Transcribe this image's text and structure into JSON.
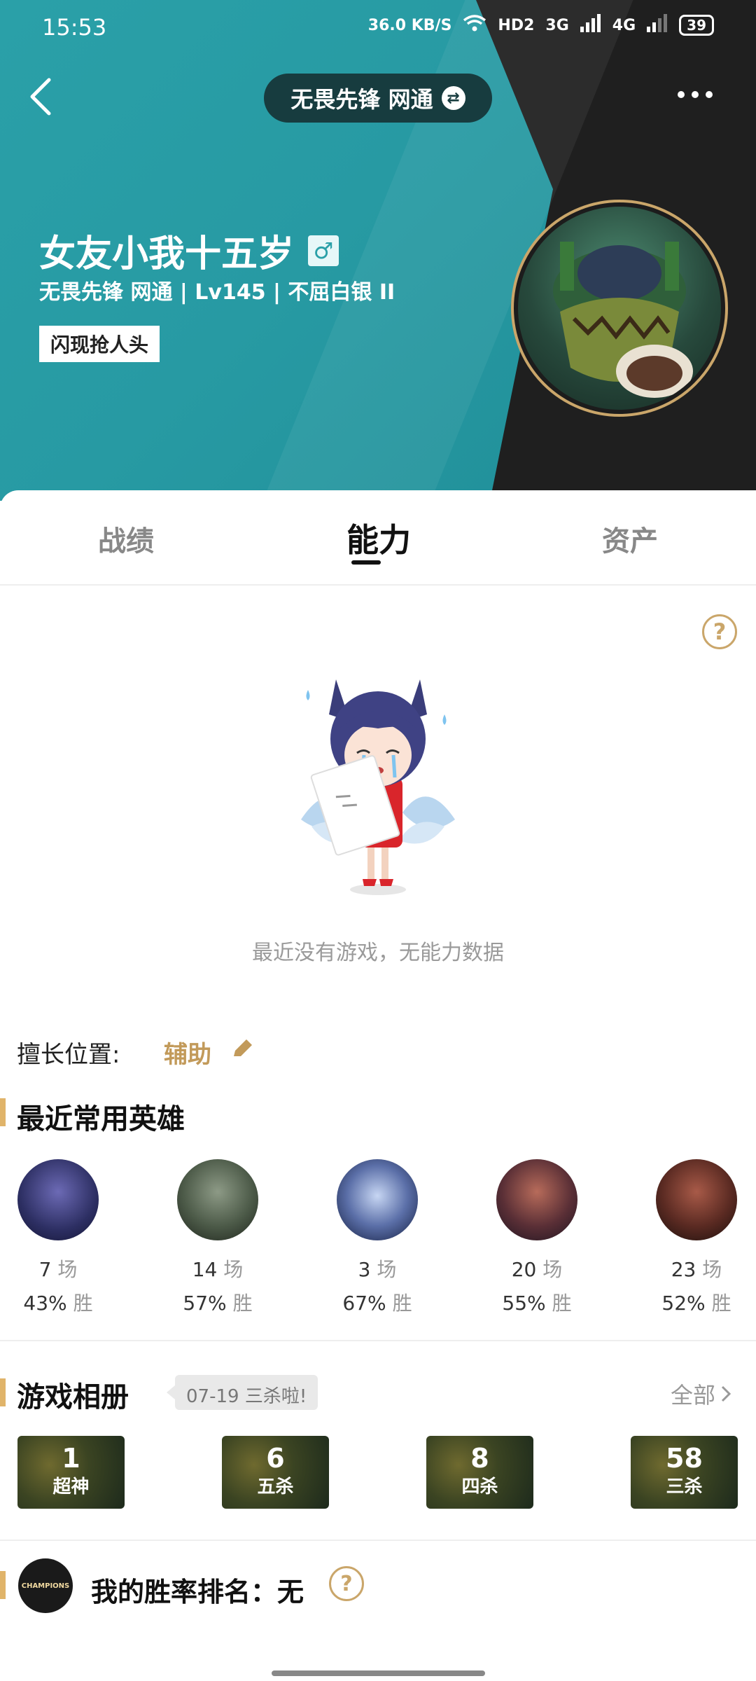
{
  "status_bar": {
    "time": "15:53",
    "net_speed": "36.0 KB/S",
    "hd": "HD2",
    "sig1": "3G",
    "sig2": "4G",
    "battery": "39"
  },
  "header": {
    "server": "无畏先锋 网通",
    "player_name": "女友小我十五岁",
    "gender_icon": "male-icon",
    "meta": "无畏先锋 网通 | Lv145 | 不屈白银 II",
    "tag": "闪现抢人头",
    "colors": {
      "teal": "#2aa0a8",
      "dark": "#1f1f1f",
      "gold": "#caa66a"
    }
  },
  "tabs": [
    {
      "label": "战绩",
      "active": false
    },
    {
      "label": "能力",
      "active": true
    },
    {
      "label": "资产",
      "active": false
    }
  ],
  "empty_state": {
    "text": "最近没有游戏，无能力数据",
    "help_icon": "?"
  },
  "position": {
    "label": "擅长位置:",
    "value": "辅助"
  },
  "recent_heroes": {
    "title": "最近常用英雄",
    "games_unit": "场",
    "win_unit": "胜",
    "items": [
      {
        "games": "7",
        "rate": "43%"
      },
      {
        "games": "14",
        "rate": "57%"
      },
      {
        "games": "3",
        "rate": "67%"
      },
      {
        "games": "20",
        "rate": "55%"
      },
      {
        "games": "23",
        "rate": "52%"
      }
    ]
  },
  "album": {
    "title": "游戏相册",
    "tip": "07-19 三杀啦!",
    "all_label": "全部",
    "cards": [
      {
        "count": "1",
        "label": "超神"
      },
      {
        "count": "6",
        "label": "五杀"
      },
      {
        "count": "8",
        "label": "四杀"
      },
      {
        "count": "58",
        "label": "三杀"
      }
    ]
  },
  "rank": {
    "text": "我的胜率排名：无",
    "logo_text": "CHAMPIONS",
    "help_icon": "?"
  }
}
